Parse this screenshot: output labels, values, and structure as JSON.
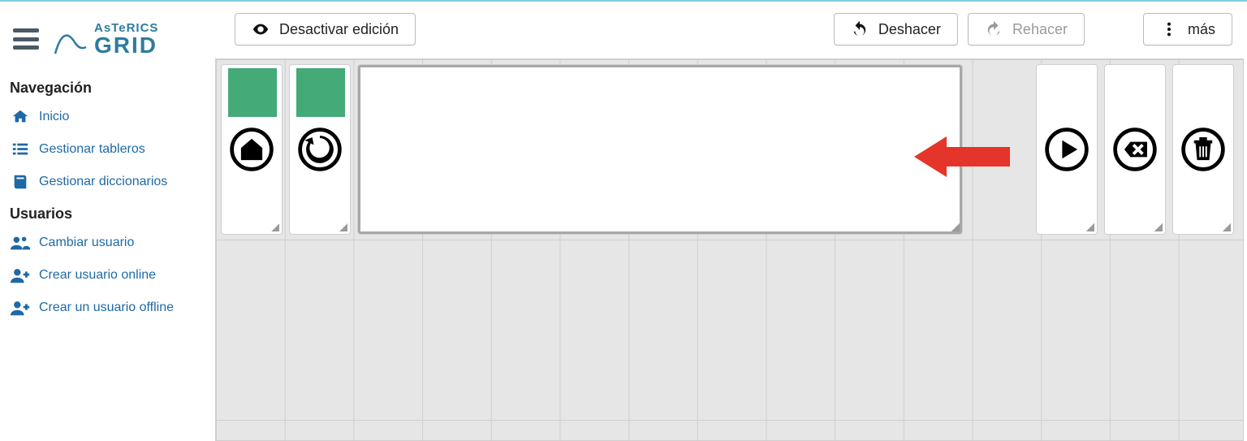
{
  "logo": {
    "line1": "AsTeRICS",
    "line2": "GRID"
  },
  "sidebar": {
    "section1_title": "Navegación",
    "items1": [
      {
        "label": "Inicio"
      },
      {
        "label": "Gestionar tableros"
      },
      {
        "label": "Gestionar diccionarios"
      }
    ],
    "section2_title": "Usuarios",
    "items2": [
      {
        "label": "Cambiar usuario"
      },
      {
        "label": "Crear usuario online"
      },
      {
        "label": "Crear un usuario offline"
      }
    ]
  },
  "toolbar": {
    "disable_edit": "Desactivar edición",
    "undo": "Deshacer",
    "redo": "Rehacer",
    "more": "más"
  },
  "cells": {
    "home": "home-icon",
    "back_rotate": "rotate-ccw-icon",
    "collect": "collect-area",
    "play": "play-icon",
    "backspace": "backspace-icon",
    "trash": "trash-icon"
  },
  "colors": {
    "accent": "#1e69a6",
    "arrow": "#e5342a"
  }
}
